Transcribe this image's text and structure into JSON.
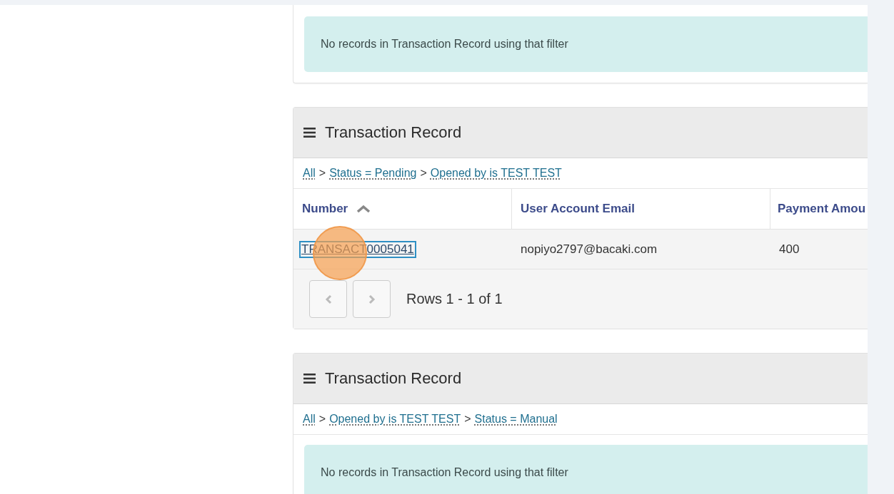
{
  "top_card": {
    "message": "No records in Transaction Record using that filter"
  },
  "lists": [
    {
      "title": "Transaction Record",
      "breadcrumb": [
        {
          "text": "All"
        },
        {
          "separator": ">",
          "text": "Status = Pending"
        },
        {
          "separator": ">",
          "text": "Opened by is TEST TEST"
        }
      ],
      "columns": [
        {
          "label": "Number",
          "sorted": true
        },
        {
          "label": "User Account Email"
        },
        {
          "label": "Payment Amou"
        }
      ],
      "rows": [
        {
          "cells": [
            "TRANSACT0005041",
            "nopiyo2797@bacaki.com",
            "400"
          ],
          "focused": true
        }
      ],
      "pager": {
        "text": "Rows 1 - 1 of 1"
      }
    },
    {
      "title": "Transaction Record",
      "breadcrumb": [
        {
          "text": "All"
        },
        {
          "separator": ">",
          "text": "Opened by is TEST TEST"
        },
        {
          "separator": ">",
          "text": "Status = Manual"
        }
      ],
      "message": "No records in Transaction Record using that filter"
    }
  ]
}
